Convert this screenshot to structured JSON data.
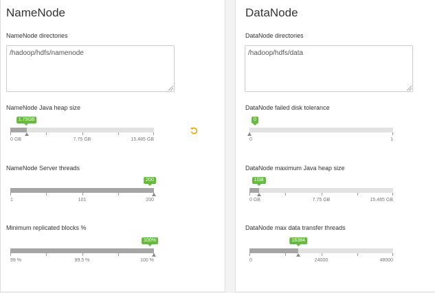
{
  "namenode": {
    "title": "NameNode",
    "directories": {
      "label": "NameNode directories",
      "value": "/hadoop/hdfs/namenode"
    },
    "heap": {
      "label": "NameNode Java heap size",
      "bubble": "1.75GB",
      "value_fraction": 0.113,
      "ticks": [
        "0 GB",
        "7.75 GB",
        "15.485 GB"
      ],
      "undo_icon": "undo-icon",
      "undo_color": "#f0a500"
    },
    "threads": {
      "label": "NameNode Server threads",
      "bubble": "200",
      "value_fraction": 1.0,
      "ticks": [
        "1",
        "101",
        "200"
      ]
    },
    "replicated": {
      "label": "Minimum replicated blocks %",
      "bubble": "100%",
      "value_fraction": 1.0,
      "ticks": [
        "99 %",
        "99.5 %",
        "100 %"
      ]
    }
  },
  "datanode": {
    "title": "DataNode",
    "directories": {
      "label": "DataNode directories",
      "value": "/hadoop/hdfs/data"
    },
    "failed_disk": {
      "label": "DataNode failed disk tolerance",
      "bubble": "0",
      "value_fraction": 0.0,
      "ticks": [
        "0",
        "1"
      ]
    },
    "heap": {
      "label": "DataNode maximum Java heap size",
      "bubble": "1GB",
      "value_fraction": 0.065,
      "ticks": [
        "0 GB",
        "7.75 GB",
        "15.485 GB"
      ]
    },
    "transfer_threads": {
      "label": "DataNode max data transfer threads",
      "bubble": "16384",
      "value_fraction": 0.341,
      "ticks": [
        "0",
        "24000",
        "48000"
      ]
    }
  },
  "colors": {
    "accent_green": "#67b93f",
    "fill_gray": "#a5a5a5",
    "track_gray": "#e2e2e2"
  }
}
